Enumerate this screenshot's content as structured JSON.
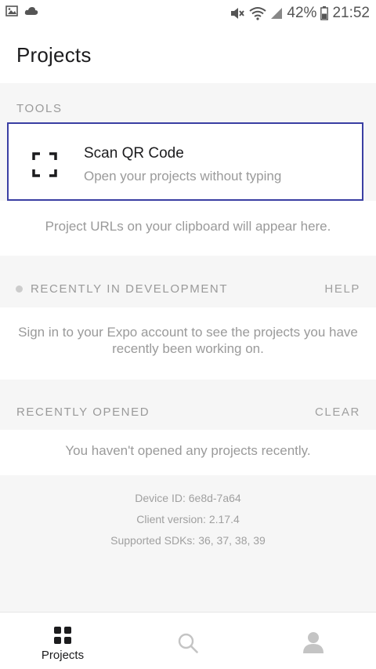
{
  "status_bar": {
    "battery": "42%",
    "time": "21:52",
    "icons": [
      "image-icon",
      "cloud-icon",
      "mute-icon",
      "wifi-icon",
      "signal-icon",
      "battery-icon"
    ]
  },
  "header": {
    "title": "Projects"
  },
  "tools": {
    "section_label": "TOOLS",
    "scan": {
      "icon": "qr-scan-icon",
      "title": "Scan QR Code",
      "subtitle": "Open your projects without typing"
    },
    "clipboard_hint": "Project URLs on your clipboard will appear here."
  },
  "recently_in_development": {
    "section_label": "RECENTLY IN DEVELOPMENT",
    "action": "HELP",
    "message": "Sign in to your Expo account to see the projects you have recently been working on."
  },
  "recently_opened": {
    "section_label": "RECENTLY OPENED",
    "action": "CLEAR",
    "message": "You haven't opened any projects recently."
  },
  "device_info": {
    "device_id": "Device ID: 6e8d-7a64",
    "client_version": "Client version: 2.17.4",
    "supported_sdks": "Supported SDKs: 36, 37, 38, 39"
  },
  "tab_bar": {
    "projects_label": "Projects",
    "icons": [
      "grid-icon",
      "search-icon",
      "profile-icon"
    ]
  },
  "colors": {
    "accent_border": "#3a3fa3",
    "background": "#f6f6f6",
    "muted_text": "#9a9a9a"
  }
}
